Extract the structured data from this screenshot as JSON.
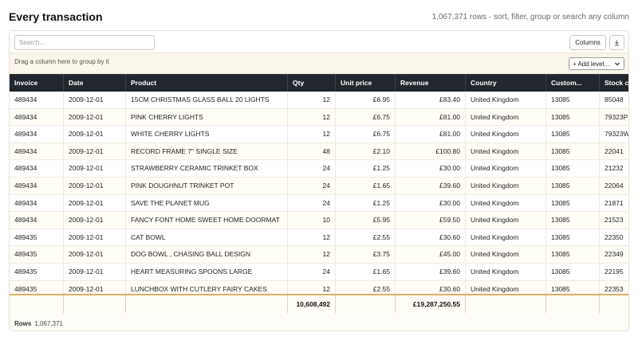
{
  "header": {
    "title": "Every transaction",
    "subtitle": "1,067,371 rows · sort, filter, group or search any column"
  },
  "toolbar": {
    "search_placeholder": "Search...",
    "columns_label": "Columns"
  },
  "group_zone": {
    "hint": "Drag a column here to group by it",
    "add_level_label": "+ Add level..."
  },
  "columns": [
    {
      "label": "Invoice"
    },
    {
      "label": "Date"
    },
    {
      "label": "Product"
    },
    {
      "label": "Qty"
    },
    {
      "label": "Unit price"
    },
    {
      "label": "Revenue"
    },
    {
      "label": "Country"
    },
    {
      "label": "Custom..."
    },
    {
      "label": "Stock c"
    }
  ],
  "rows": [
    {
      "invoice": "489434",
      "date": "2009-12-01",
      "product": "15CM CHRISTMAS GLASS BALL 20 LIGHTS",
      "qty": "12",
      "unit_price": "£6.95",
      "revenue": "£83.40",
      "country": "United Kingdom",
      "customer": "13085",
      "stock": "85048"
    },
    {
      "invoice": "489434",
      "date": "2009-12-01",
      "product": "PINK CHERRY LIGHTS",
      "qty": "12",
      "unit_price": "£6.75",
      "revenue": "£81.00",
      "country": "United Kingdom",
      "customer": "13085",
      "stock": "79323P"
    },
    {
      "invoice": "489434",
      "date": "2009-12-01",
      "product": "WHITE CHERRY LIGHTS",
      "qty": "12",
      "unit_price": "£6.75",
      "revenue": "£81.00",
      "country": "United Kingdom",
      "customer": "13085",
      "stock": "79323W"
    },
    {
      "invoice": "489434",
      "date": "2009-12-01",
      "product": "RECORD FRAME 7\" SINGLE SIZE",
      "qty": "48",
      "unit_price": "£2.10",
      "revenue": "£100.80",
      "country": "United Kingdom",
      "customer": "13085",
      "stock": "22041"
    },
    {
      "invoice": "489434",
      "date": "2009-12-01",
      "product": "STRAWBERRY CERAMIC TRINKET BOX",
      "qty": "24",
      "unit_price": "£1.25",
      "revenue": "£30.00",
      "country": "United Kingdom",
      "customer": "13085",
      "stock": "21232"
    },
    {
      "invoice": "489434",
      "date": "2009-12-01",
      "product": "PINK DOUGHNUT TRINKET POT",
      "qty": "24",
      "unit_price": "£1.65",
      "revenue": "£39.60",
      "country": "United Kingdom",
      "customer": "13085",
      "stock": "22064"
    },
    {
      "invoice": "489434",
      "date": "2009-12-01",
      "product": "SAVE THE PLANET MUG",
      "qty": "24",
      "unit_price": "£1.25",
      "revenue": "£30.00",
      "country": "United Kingdom",
      "customer": "13085",
      "stock": "21871"
    },
    {
      "invoice": "489434",
      "date": "2009-12-01",
      "product": "FANCY FONT HOME SWEET HOME DOORMAT",
      "qty": "10",
      "unit_price": "£5.95",
      "revenue": "£59.50",
      "country": "United Kingdom",
      "customer": "13085",
      "stock": "21523"
    },
    {
      "invoice": "489435",
      "date": "2009-12-01",
      "product": "CAT BOWL",
      "qty": "12",
      "unit_price": "£2.55",
      "revenue": "£30.60",
      "country": "United Kingdom",
      "customer": "13085",
      "stock": "22350"
    },
    {
      "invoice": "489435",
      "date": "2009-12-01",
      "product": "DOG BOWL , CHASING BALL DESIGN",
      "qty": "12",
      "unit_price": "£3.75",
      "revenue": "£45.00",
      "country": "United Kingdom",
      "customer": "13085",
      "stock": "22349"
    },
    {
      "invoice": "489435",
      "date": "2009-12-01",
      "product": "HEART MEASURING SPOONS LARGE",
      "qty": "24",
      "unit_price": "£1.65",
      "revenue": "£39.60",
      "country": "United Kingdom",
      "customer": "13085",
      "stock": "22195"
    },
    {
      "invoice": "489435",
      "date": "2009-12-01",
      "product": "LUNCHBOX WITH CUTLERY FAIRY CAKES",
      "qty": "12",
      "unit_price": "£2.55",
      "revenue": "£30.60",
      "country": "United Kingdom",
      "customer": "13085",
      "stock": "22353"
    }
  ],
  "totals": {
    "qty": "10,608,492",
    "revenue": "£19,287,250.55"
  },
  "status": {
    "label": "Rows",
    "value": "1,067,371"
  },
  "icons": {
    "export": "download-icon",
    "dropdown": "chevron-down-icon"
  },
  "colors": {
    "header_bg": "#22272d",
    "totals_accent": "#d4b06a",
    "group_zone_bg": "#fbf6ea"
  }
}
